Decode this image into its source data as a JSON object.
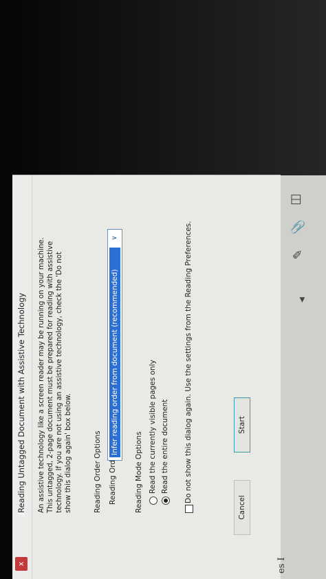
{
  "dialog": {
    "title": "Reading Untagged Document with Assistive Technology",
    "close_label": "x",
    "description": [
      "An assistive technology like a screen reader may be running on your machine.",
      "This untagged, 2-page document must be prepared for reading with assistive",
      "technology. If you are not using an assistive technology, check the 'Do not",
      "show this dialog again' box below."
    ],
    "reading_order_section": "Reading Order Options",
    "reading_order_label": "Reading Order:",
    "reading_order_value": "Infer reading order from document (recommended)",
    "reading_mode_section": "Reading Mode Options",
    "radio_options": [
      {
        "label": "Read the currently visible pages only",
        "checked": false
      },
      {
        "label": "Read the entire document",
        "checked": true
      }
    ],
    "checkbox_label": "Do not show this dialog again. Use the settings from the Reading Preferences.",
    "start_label": "Start",
    "cancel_label": "Cancel"
  },
  "background_text": "es I",
  "icons": [
    "pages-icon",
    "attachment-icon",
    "sign-icon"
  ],
  "colors": {
    "close": "#c23a3a",
    "selection": "#2a6fd1",
    "start_border": "#3a9aa8"
  }
}
